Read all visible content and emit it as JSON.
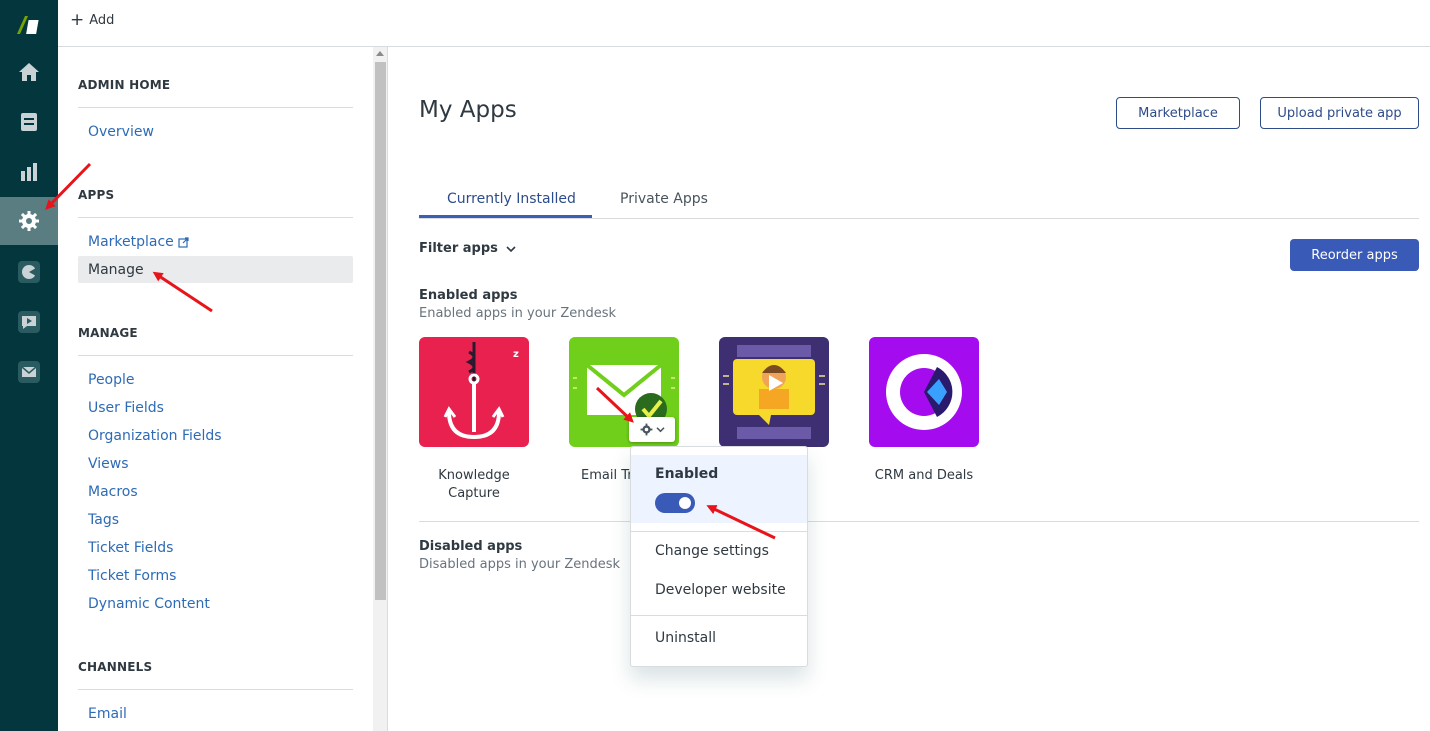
{
  "topbar": {
    "add_label": "Add"
  },
  "rail": {
    "items": [
      {
        "icon": "zendesk-logo-icon"
      },
      {
        "icon": "home-icon"
      },
      {
        "icon": "views-icon"
      },
      {
        "icon": "reporting-icon"
      },
      {
        "icon": "admin-gear-icon",
        "active": true
      },
      {
        "icon": "chat-icon"
      },
      {
        "icon": "talk-icon"
      },
      {
        "icon": "mail-icon"
      }
    ]
  },
  "adminnav": {
    "admin_home": "ADMIN HOME",
    "overview": "Overview",
    "apps_head": "APPS",
    "marketplace": "Marketplace",
    "manage": "Manage",
    "manage_head": "MANAGE",
    "manage_items": [
      "People",
      "User Fields",
      "Organization Fields",
      "Views",
      "Macros",
      "Tags",
      "Ticket Fields",
      "Ticket Forms",
      "Dynamic Content"
    ],
    "channels_head": "CHANNELS",
    "channels_items": [
      "Email"
    ]
  },
  "main": {
    "title": "My Apps",
    "marketplace_btn": "Marketplace",
    "upload_btn": "Upload private app",
    "tabs": [
      "Currently Installed",
      "Private Apps"
    ],
    "filter_label": "Filter apps",
    "reorder_btn": "Reorder apps",
    "enabled_title": "Enabled apps",
    "enabled_sub": "Enabled apps in your Zendesk",
    "disabled_title": "Disabled apps",
    "disabled_sub": "Disabled apps in your Zendesk",
    "apps": [
      {
        "name": "Knowledge Capture",
        "color": "#e8214f"
      },
      {
        "name": "Email Tr",
        "color": "#6fcf1a"
      },
      {
        "name": "",
        "color": "#3e2f73"
      },
      {
        "name": "CRM and Deals",
        "color": "#a50bef"
      }
    ]
  },
  "menu": {
    "enabled_label": "Enabled",
    "enabled_on": true,
    "items": [
      "Change settings",
      "Developer website",
      "Uninstall"
    ]
  },
  "colors": {
    "rail": "#03363d",
    "accent": "#3a5ab8",
    "link": "#2d6bb5"
  }
}
